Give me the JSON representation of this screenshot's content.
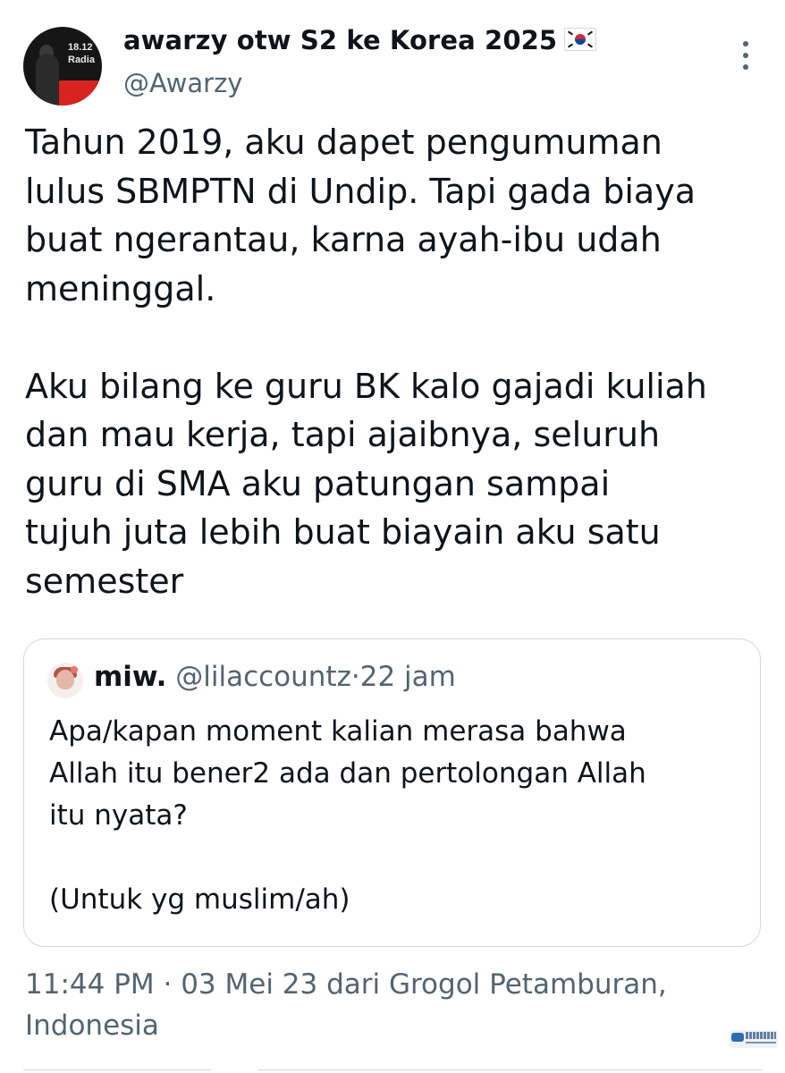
{
  "author": {
    "display_name": "awarzy otw S2 ke Korea 2025",
    "flag_icon": "south-korea-flag",
    "handle": "@Awarzy",
    "avatar_text": [
      "18.12",
      "Radia"
    ]
  },
  "tweet": {
    "text": "Tahun 2019, aku dapet pengumuman\nlulus SBMPTN di Undip. Tapi gada biaya\nbuat ngerantau, karna ayah-ibu udah\nmeninggal.\n\nAku bilang ke guru BK kalo gajadi kuliah\ndan mau kerja, tapi ajaibnya, seluruh\nguru di SMA aku patungan sampai\ntujuh juta lebih buat biayain aku satu\nsemester"
  },
  "quoted_tweet": {
    "display_name": "miw.",
    "handle": "@lilaccountz",
    "separator": "·",
    "time": "22 jam",
    "text": "Apa/kapan moment kalian merasa bahwa\nAllah itu bener2 ada dan pertolongan Allah\nitu nyata?\n\n(Untuk yg muslim/ah)"
  },
  "meta": {
    "line": "11:44 PM · 03 Mei 23 dari Grogol Petamburan, Indonesia"
  },
  "colors": {
    "text_primary": "#0f1419",
    "text_secondary": "#536471",
    "border": "#cfd9de",
    "background": "#ffffff"
  },
  "icons": {
    "more": "more-vertical-icon"
  }
}
